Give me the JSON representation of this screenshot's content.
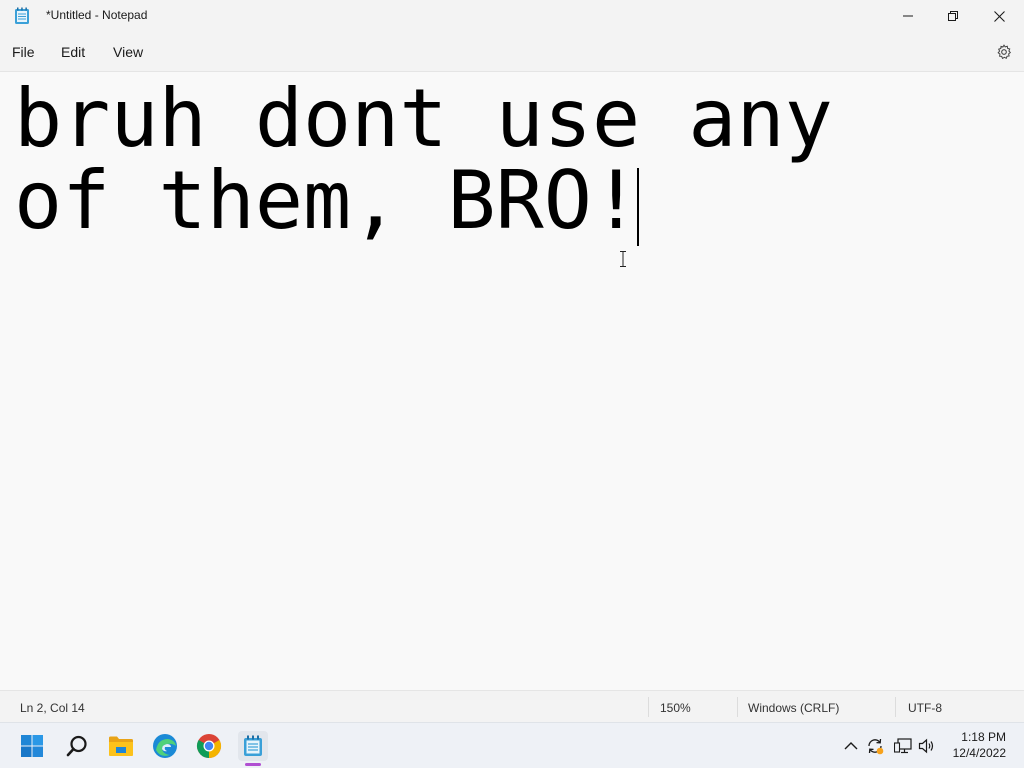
{
  "window": {
    "title": "*Untitled - Notepad"
  },
  "menu": {
    "file": "File",
    "edit": "Edit",
    "view": "View"
  },
  "editor": {
    "line1": "bruh dont use any",
    "line2": "of them, BRO!"
  },
  "status": {
    "position": "Ln 2, Col 14",
    "zoom": "150%",
    "line_ending": "Windows (CRLF)",
    "encoding": "UTF-8"
  },
  "taskbar": {
    "time": "1:18 PM",
    "date": "12/4/2022"
  },
  "colors": {
    "accent": "#0067c0",
    "active_indicator": "#b04fd2"
  }
}
